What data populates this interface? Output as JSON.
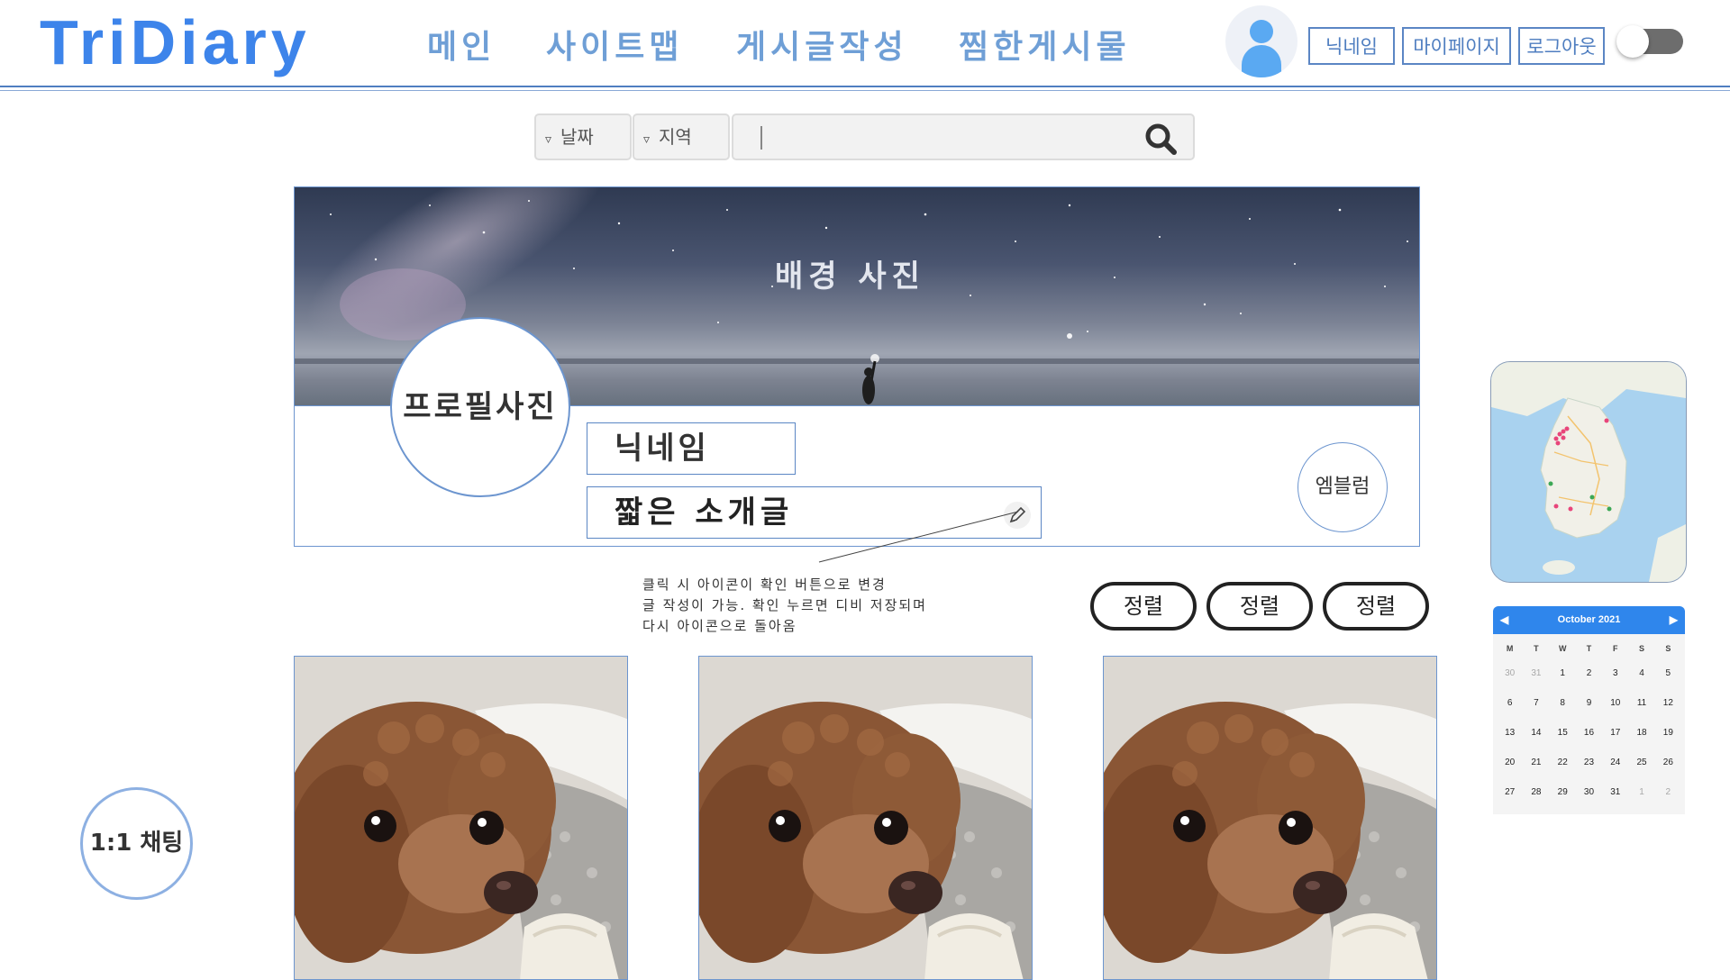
{
  "header": {
    "logo": "TriDiary",
    "nav": [
      "메인",
      "사이트맵",
      "게시글작성",
      "찜한게시물"
    ],
    "buttons": {
      "nickname": "닉네임",
      "mypage": "마이페이지",
      "logout": "로그아웃"
    },
    "icons": {
      "avatar": "user-avatar-icon",
      "toggle": "toggle-switch"
    }
  },
  "search": {
    "date_label": "날짜",
    "region_label": "지역",
    "dropdown_marker": "▿",
    "query_value": "",
    "icon": "search-icon"
  },
  "profile": {
    "banner_label": "배경 사진",
    "photo_label": "프로필사진",
    "nickname": "닉네임",
    "intro": "짧은 소개글",
    "emblem_label": "엠블럼",
    "edit_icon": "pencil-icon",
    "note_lines": [
      "클릭 시 아이콘이 확인 버튼으로 변경",
      "글 작성이 가능. 확인 누르면 디비 저장되며",
      "다시 아이콘으로 돌아옴"
    ]
  },
  "sort_buttons": [
    "정렬",
    "정렬",
    "정렬"
  ],
  "posts": [
    {
      "image": "poodle-photo"
    },
    {
      "image": "poodle-photo"
    },
    {
      "image": "poodle-photo"
    }
  ],
  "chat": {
    "label": "1:1 채팅"
  },
  "calendar": {
    "title": "October 2021",
    "prev_icon": "chevron-left-icon",
    "next_icon": "chevron-right-icon",
    "weekdays": [
      "M",
      "T",
      "W",
      "T",
      "F",
      "S",
      "S"
    ],
    "weeks": [
      [
        "30",
        "31",
        "1",
        "2",
        "3",
        "4",
        "5"
      ],
      [
        "6",
        "7",
        "8",
        "9",
        "10",
        "11",
        "12"
      ],
      [
        "13",
        "14",
        "15",
        "16",
        "17",
        "18",
        "19"
      ],
      [
        "20",
        "21",
        "22",
        "23",
        "24",
        "25",
        "26"
      ],
      [
        "27",
        "28",
        "29",
        "30",
        "31",
        "1",
        "2"
      ]
    ],
    "muted": [
      [
        0,
        0
      ],
      [
        0,
        1
      ],
      [
        4,
        5
      ],
      [
        4,
        6
      ]
    ]
  },
  "map": {
    "icon": "korea-map-thumbnail"
  }
}
